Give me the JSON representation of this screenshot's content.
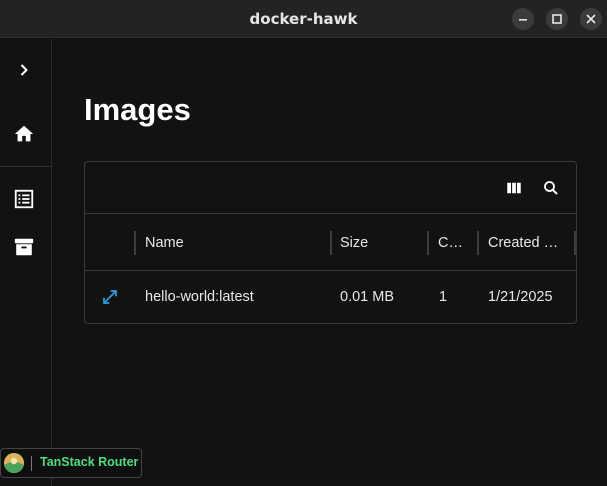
{
  "window": {
    "title": "docker-hawk"
  },
  "sidebar": {
    "items": [
      {
        "icon": "chevron-right-icon"
      },
      {
        "icon": "home-icon"
      },
      {
        "icon": "list-icon"
      },
      {
        "icon": "archive-icon"
      }
    ]
  },
  "main": {
    "title": "Images",
    "table": {
      "toolbar": {
        "icons": [
          "columns-icon",
          "search-icon"
        ]
      },
      "columns": [
        "Name",
        "Size",
        "C…",
        "Created …"
      ],
      "rows": [
        {
          "name": "hello-world:latest",
          "size": "0.01 MB",
          "containers": "1",
          "created": "1/21/2025"
        }
      ]
    }
  },
  "devtools": {
    "label": "TanStack Router"
  },
  "colors": {
    "background": "#121212",
    "titlebar": "#232323",
    "accent_blue": "#29a3e6",
    "tanstack_green": "#4ade80"
  }
}
